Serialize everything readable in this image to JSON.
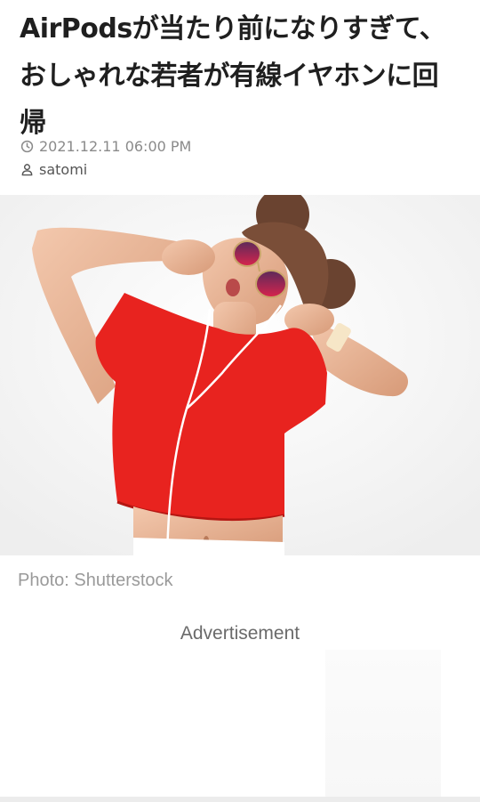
{
  "article": {
    "title": "AirPodsが当たり前になりすぎて、おしゃれな若者が有線イヤホンに回帰",
    "date": "2021.12.11 06:00 PM",
    "author": "satomi"
  },
  "image": {
    "caption": "Photo: Shutterstock"
  },
  "ad": {
    "label": "Advertisement"
  },
  "icons": {
    "date": "clock-icon",
    "author": "user-icon"
  },
  "colors": {
    "shirt": "#e8231f",
    "meta_text": "#8a8a8a",
    "title_text": "#1f1f1f"
  }
}
